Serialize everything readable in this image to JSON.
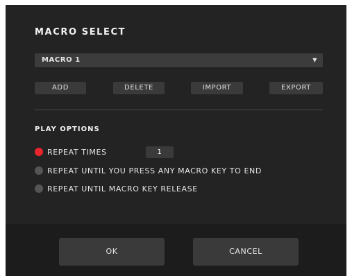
{
  "dialog": {
    "title": "MACRO SELECT",
    "macro_select": {
      "value": "MACRO 1",
      "arrow_icon": "triangle-down-icon"
    },
    "buttons": {
      "add": "ADD",
      "delete": "DELETE",
      "import": "IMPORT",
      "export": "EXPORT"
    },
    "play_options": {
      "heading": "PLAY OPTIONS",
      "options": [
        {
          "label": "REPEAT TIMES",
          "selected": true
        },
        {
          "label": "REPEAT UNTIL YOU PRESS ANY MACRO KEY TO END",
          "selected": false
        },
        {
          "label": "REPEAT UNTIL MACRO KEY RELEASE",
          "selected": false
        }
      ],
      "repeat_times_value": "1"
    },
    "footer": {
      "ok": "OK",
      "cancel": "CANCEL"
    },
    "colors": {
      "accent_selected": "#e8242c",
      "background": "#232323",
      "control": "#3a3a3a"
    }
  }
}
